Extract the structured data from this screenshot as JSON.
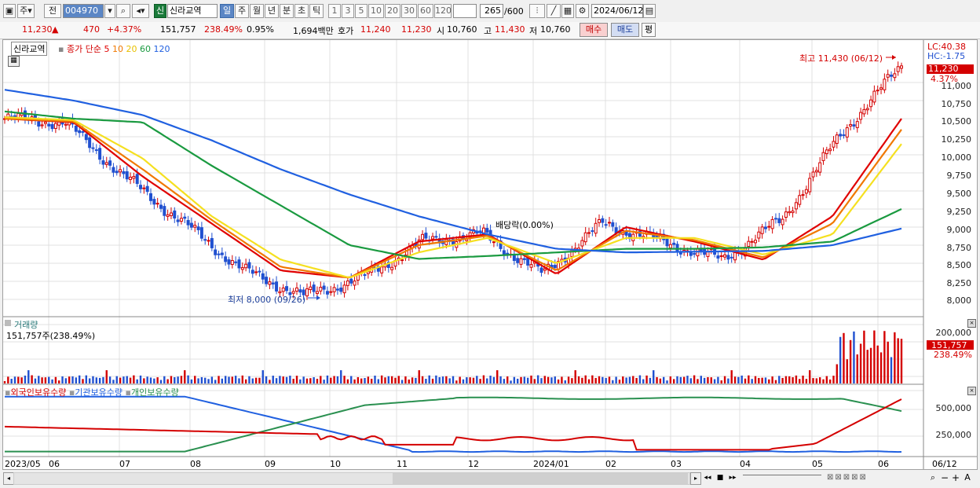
{
  "toolbar": {
    "market_a": "주",
    "market_b": "전",
    "code": "004970",
    "badge": "신",
    "name": "신라교역",
    "periods": [
      "일",
      "주",
      "월",
      "년",
      "분",
      "초",
      "틱"
    ],
    "selected_period": "일",
    "intervals": [
      "1",
      "3",
      "5",
      "10",
      "20",
      "30",
      "60",
      "120"
    ],
    "count": "265",
    "count_total": "/600",
    "date": "2024/06/12"
  },
  "quote": {
    "price": "11,230",
    "arrow": "▲",
    "change": "470",
    "change_pct": "+4.37%",
    "volume": "151,757",
    "volume_ratio": "238.49%",
    "turnover": "0.95%",
    "amount": "1,694백만",
    "bid_label": "호가",
    "bid": "11,240",
    "ask": "11,230",
    "open_label": "시",
    "open": "10,760",
    "high_label": "고",
    "high": "11,430",
    "low_label": "저",
    "low": "10,760",
    "buy_label": "매수",
    "sell_label": "매도",
    "eval_label": "평"
  },
  "price_panel": {
    "stock_label": "신라교역",
    "legend_prefix": "종가 단순",
    "ma_periods": [
      "5",
      "10",
      "20",
      "60",
      "120"
    ],
    "ma_colors": [
      "#e00000",
      "#f07800",
      "#f5e020",
      "#1a9a40",
      "#2060e0"
    ],
    "lc": "LC:40.38",
    "hc": "HC:-1.75",
    "last_price": "11,230",
    "last_pct": "4.37%",
    "high_annotation": "최고 11,430 (06/12)",
    "low_annotation": "최저 8,000 (09/26)",
    "dividend_annotation": "배당락(0.00%)",
    "y_ticks": [
      "11,000",
      "10,750",
      "10,500",
      "10,250",
      "10,000",
      "9,750",
      "9,500",
      "9,250",
      "9,000",
      "8,750",
      "8,500",
      "8,250",
      "8,000"
    ]
  },
  "volume_panel": {
    "title": "거래량",
    "value": "151,757주(238.49%)",
    "y_ticks": [
      "200,000"
    ],
    "last_value": "151,757",
    "last_pct": "238.49%"
  },
  "holding_panel": {
    "foreign": "외국인보유수량",
    "institution": "기관보유수량",
    "individual": "개인보유수량",
    "y_ticks": [
      "500,000",
      "250,000"
    ]
  },
  "x_labels": [
    "2023/05",
    "06",
    "07",
    "08",
    "09",
    "10",
    "11",
    "12",
    "2024/01",
    "02",
    "03",
    "04",
    "05",
    "06"
  ],
  "x_right_label": "06/12",
  "colors": {
    "up": "#d40000",
    "down": "#2050d0",
    "grid": "#e0e0e0",
    "foreign": "#d40000",
    "institution": "#2060e0",
    "individual": "#2a9050"
  },
  "chart_data": {
    "type": "candlestick",
    "title": "신라교역",
    "x_range": [
      "2023/05",
      "2024/06/12"
    ],
    "price_ylim": [
      7900,
      11500
    ],
    "close_series_approx": [
      {
        "x": "2023/05",
        "close": 10500
      },
      {
        "x": "2023/06",
        "close": 10450
      },
      {
        "x": "2023/07",
        "close": 9700
      },
      {
        "x": "2023/08",
        "close": 9050
      },
      {
        "x": "2023/09",
        "close": 8400
      },
      {
        "x": "2023/09/26",
        "close": 8050
      },
      {
        "x": "2023/10",
        "close": 8300
      },
      {
        "x": "2023/11",
        "close": 8800
      },
      {
        "x": "2023/12",
        "close": 8900
      },
      {
        "x": "2024/01",
        "close": 8350
      },
      {
        "x": "2024/02",
        "close": 9050
      },
      {
        "x": "2024/03",
        "close": 8800
      },
      {
        "x": "2024/04",
        "close": 8550
      },
      {
        "x": "2024/05",
        "close": 9100
      },
      {
        "x": "2024/06",
        "close": 10300
      },
      {
        "x": "2024/06/12",
        "close": 11230
      }
    ],
    "ma_series": [
      {
        "name": "5",
        "values": [
          10500,
          10450,
          9700,
          9050,
          8400,
          8300,
          8800,
          8900,
          8350,
          9000,
          8800,
          8550,
          9150,
          10500
        ]
      },
      {
        "name": "10",
        "values": [
          10500,
          10460,
          9800,
          9100,
          8450,
          8300,
          8750,
          8880,
          8400,
          8950,
          8820,
          8580,
          9050,
          10350
        ]
      },
      {
        "name": "20",
        "values": [
          10520,
          10480,
          9950,
          9150,
          8550,
          8300,
          8650,
          8850,
          8500,
          8850,
          8850,
          8620,
          8900,
          10150
        ]
      },
      {
        "name": "60",
        "values": [
          10600,
          10500,
          10450,
          9850,
          9300,
          8750,
          8560,
          8600,
          8650,
          8700,
          8700,
          8720,
          8800,
          9250
        ]
      },
      {
        "name": "120",
        "values": [
          10900,
          10750,
          10550,
          10200,
          9800,
          9450,
          9150,
          8900,
          8700,
          8650,
          8660,
          8670,
          8750,
          8980
        ]
      }
    ],
    "volume_ylim": [
      0,
      250000
    ],
    "holdings_ylim": [
      0,
      750000
    ]
  }
}
